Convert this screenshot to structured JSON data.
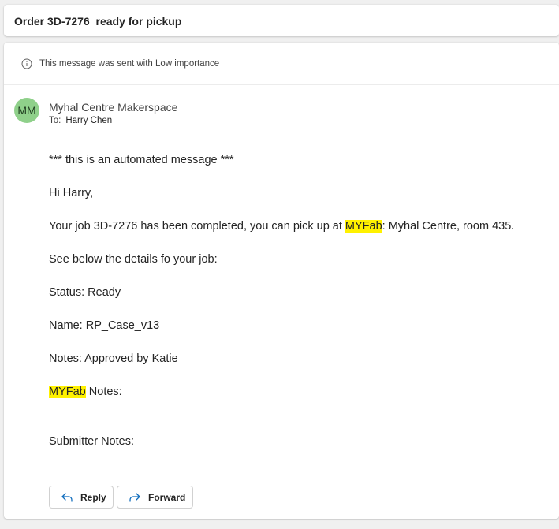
{
  "subject": "Order 3D-7276  ready for pickup",
  "importance_notice": "This message was sent with Low importance",
  "sender": {
    "initials": "MM",
    "name": "Myhal Centre Makerspace",
    "to_label": "To:",
    "to_name": "Harry Chen"
  },
  "body": {
    "automated": "*** this is an automated message ***",
    "greeting": "Hi Harry,",
    "pickup_before": "Your job 3D-7276 has been completed, you can pick up at ",
    "pickup_highlight": "MYFab",
    "pickup_after": ": Myhal Centre, room 435.",
    "details_intro": "See below the details fo your job:",
    "status": "Status: Ready",
    "name": "Name: RP_Case_v13",
    "notes": "Notes: Approved by Katie",
    "myfab_highlight": "MYFab",
    "myfab_notes_after": " Notes:",
    "submitter_notes": "Submitter Notes:"
  },
  "actions": {
    "reply_label": "Reply",
    "forward_label": "Forward"
  },
  "icons": {
    "info": "info-icon",
    "reply": "reply-arrow-icon",
    "forward": "forward-arrow-icon"
  },
  "colors": {
    "highlight": "#fff100",
    "avatar": "#8fd08a",
    "action_icon": "#0f6cbd"
  }
}
